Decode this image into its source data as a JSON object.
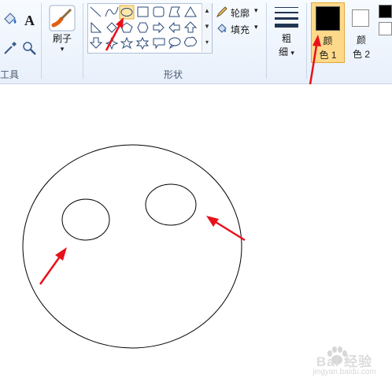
{
  "ribbon": {
    "tools_group_label": "工具",
    "brushes": {
      "label": "刷子",
      "arrow": "▾"
    },
    "shapes_group_label": "形状",
    "outline": {
      "label": "轮廓",
      "arrow": "▾"
    },
    "fill": {
      "label": "填充",
      "arrow": "▾"
    },
    "size": {
      "label_top": "粗",
      "label_bottom": "细",
      "arrow": "▾"
    },
    "color1": {
      "label_top": "颜",
      "label_bottom": "色 1",
      "color": "#000000"
    },
    "color2": {
      "label_top": "颜",
      "label_bottom": "色 2",
      "color": "#ffffff"
    },
    "accent_color": "#ffd98a"
  },
  "canvas": {
    "annotation_color": "#e8111a"
  },
  "watermark": {
    "text": "Bai 经验",
    "subtext": "jingyan.baidu.com"
  }
}
